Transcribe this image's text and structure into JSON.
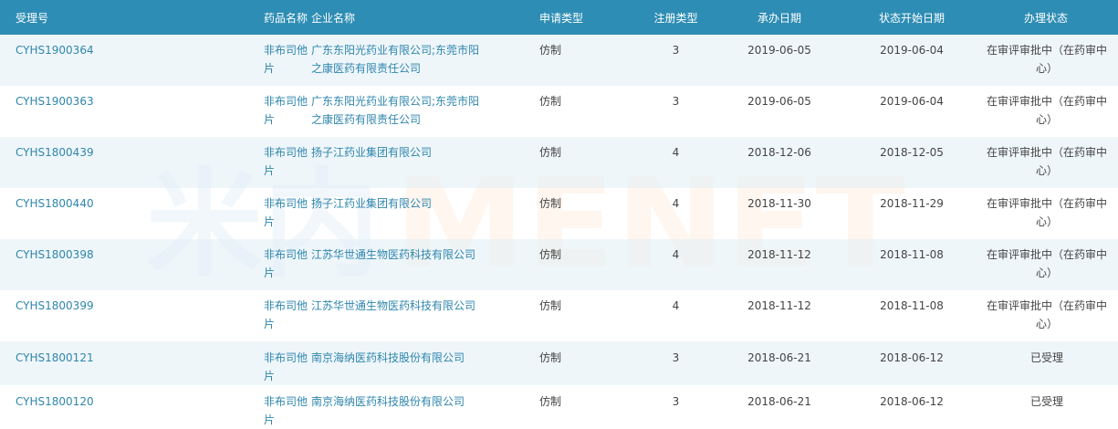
{
  "watermark": {
    "cn": "米内",
    "en": "MENET"
  },
  "columns": [
    "受理号",
    "药品名称",
    "企业名称",
    "申请类型",
    "注册类型",
    "承办日期",
    "状态开始日期",
    "办理状态"
  ],
  "rows": [
    [
      "CYHS1900364",
      "非布司他片",
      "广东东阳光药业有限公司;东莞市阳之康医药有限责任公司",
      "仿制",
      "3",
      "2019-06-05",
      "2019-06-04",
      "在审评审批中（在药审中心）"
    ],
    [
      "CYHS1900363",
      "非布司他片",
      "广东东阳光药业有限公司;东莞市阳之康医药有限责任公司",
      "仿制",
      "3",
      "2019-06-05",
      "2019-06-04",
      "在审评审批中（在药审中心）"
    ],
    [
      "CYHS1800439",
      "非布司他片",
      "扬子江药业集团有限公司",
      "仿制",
      "4",
      "2018-12-06",
      "2018-12-05",
      "在审评审批中（在药审中心）"
    ],
    [
      "CYHS1800440",
      "非布司他片",
      "扬子江药业集团有限公司",
      "仿制",
      "4",
      "2018-11-30",
      "2018-11-29",
      "在审评审批中（在药审中心）"
    ],
    [
      "CYHS1800398",
      "非布司他片",
      "江苏华世通生物医药科技有限公司",
      "仿制",
      "4",
      "2018-11-12",
      "2018-11-08",
      "在审评审批中（在药审中心）"
    ],
    [
      "CYHS1800399",
      "非布司他片",
      "江苏华世通生物医药科技有限公司",
      "仿制",
      "4",
      "2018-11-12",
      "2018-11-08",
      "在审评审批中（在药审中心）"
    ],
    [
      "CYHS1800121",
      "非布司他片",
      "南京海纳医药科技股份有限公司",
      "仿制",
      "3",
      "2018-06-21",
      "2018-06-12",
      "已受理"
    ],
    [
      "CYHS1800120",
      "非布司他片",
      "南京海纳医药科技股份有限公司",
      "仿制",
      "3",
      "2018-06-21",
      "2018-06-12",
      "已受理"
    ]
  ],
  "colors": {
    "header_bg": "#2e8db4",
    "link": "#2e86ad",
    "row_alt": "#eaf4f9"
  }
}
